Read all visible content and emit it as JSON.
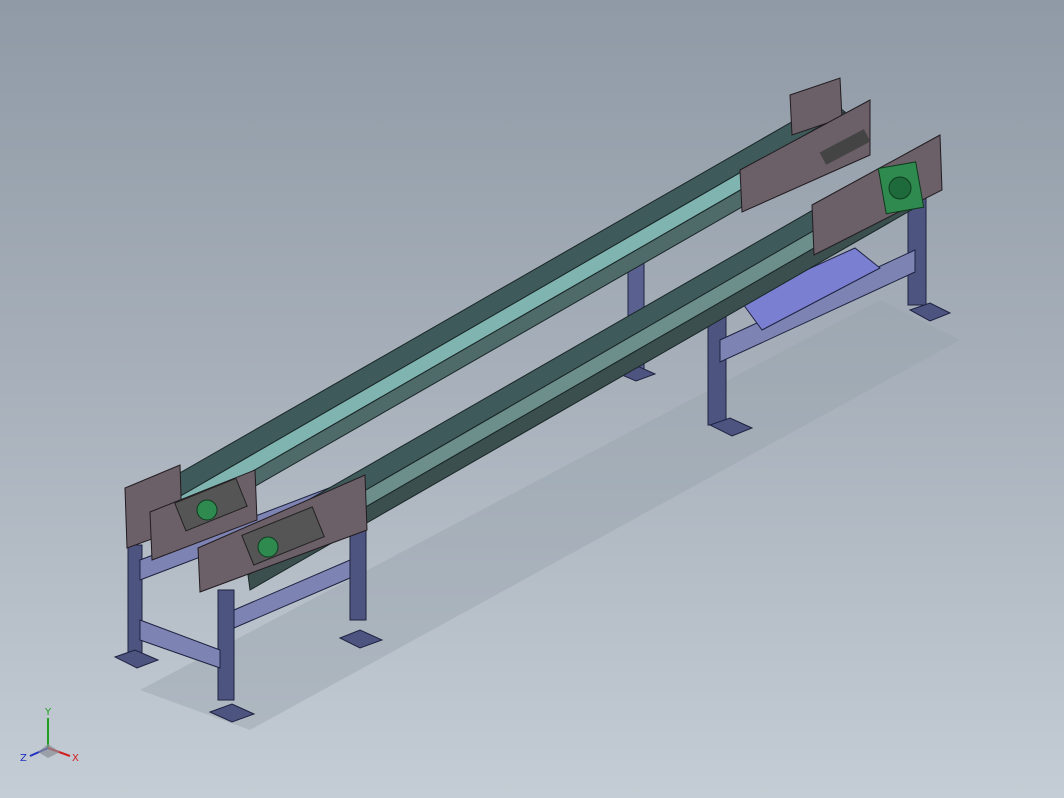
{
  "viewport": {
    "background_top": "#8f9aa6",
    "background_bottom": "#c4ccd5",
    "model_name": "",
    "colors": {
      "frame": "#4d5480",
      "frame_light": "#7d83b3",
      "rail": "#3f5a5a",
      "rail_light": "#7fb4b0",
      "plate": "#6b5f68",
      "bearing": "#2f8a4f",
      "motor_part": "#b23a2e",
      "base_plate": "#7b7fd1"
    }
  },
  "triad": {
    "icon": "coordinate-triad-icon",
    "x_label": "X",
    "y_label": "Y",
    "z_label": "Z",
    "x_color": "#d02020",
    "y_color": "#20a020",
    "z_color": "#2030c0"
  }
}
